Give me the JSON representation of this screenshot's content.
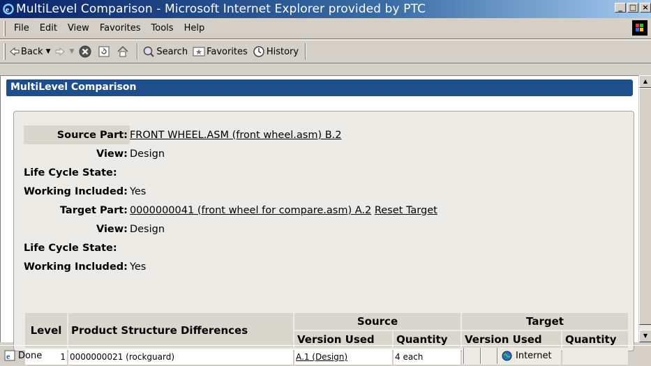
{
  "window": {
    "title": "MultiLevel Comparison - Microsoft Internet Explorer provided by PTC",
    "minimize_glyph": "_",
    "maximize_glyph": "□",
    "close_glyph": "×"
  },
  "menu": {
    "items": [
      "File",
      "Edit",
      "View",
      "Favorites",
      "Tools",
      "Help"
    ]
  },
  "toolbar": {
    "back_label": "Back",
    "search_label": "Search",
    "favorites_label": "Favorites",
    "history_label": "History"
  },
  "page": {
    "header": "MultiLevel Comparison",
    "source": {
      "label": "Source Part:",
      "value": "FRONT WHEEL.ASM (front wheel.asm) B.2",
      "view_label": "View:",
      "view_value": "Design",
      "lifecycle_label": "Life Cycle State:",
      "lifecycle_value": "",
      "working_label": "Working Included:",
      "working_value": "Yes"
    },
    "target": {
      "label": "Target Part:",
      "value": "0000000041 (front wheel for compare.asm) A.2",
      "reset_label": "Reset Target",
      "view_label": "View:",
      "view_value": "Design",
      "lifecycle_label": "Life Cycle State:",
      "lifecycle_value": "",
      "working_label": "Working Included:",
      "working_value": "Yes"
    },
    "comparison": {
      "headers": {
        "level": "Level",
        "differences": "Product Structure Differences",
        "source": "Source",
        "target": "Target",
        "source_version": "Version Used",
        "source_quantity": "Quantity",
        "target_version": "Version Used",
        "target_quantity": "Quantity"
      },
      "rows": [
        {
          "level": "1",
          "part": "0000000021 (rockguard)",
          "source_version": "A.1 (Design)",
          "source_quantity": "4 each",
          "target_version": "",
          "target_quantity": ""
        }
      ]
    }
  },
  "status": {
    "text": "Done",
    "zone": "Internet"
  },
  "colors": {
    "header_bg": "#1f4e8c",
    "panel_bg": "#ecebe6",
    "label_shade": "#d8d6cd"
  }
}
